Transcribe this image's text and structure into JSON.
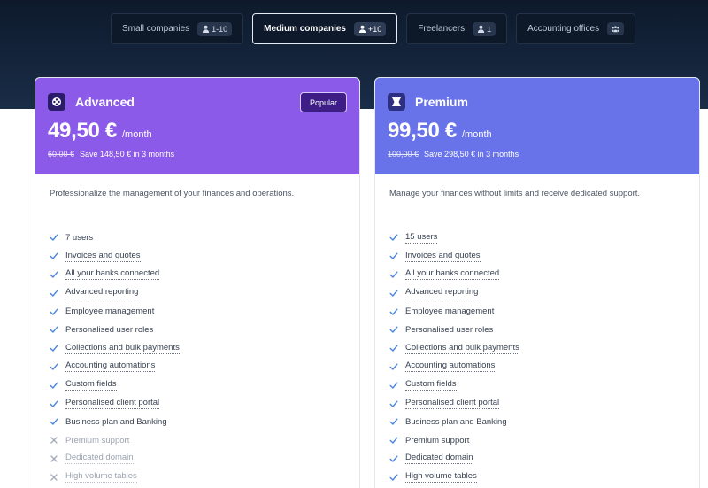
{
  "tabs": [
    {
      "label": "Small companies",
      "count": "1-10",
      "icon": "user-icon",
      "active": false
    },
    {
      "label": "Medium companies",
      "count": "+10",
      "icon": "user-icon",
      "active": true
    },
    {
      "label": "Freelancers",
      "count": "1",
      "icon": "user-icon",
      "active": false
    },
    {
      "label": "Accounting offices",
      "count": "",
      "icon": "group-icon",
      "active": false
    }
  ],
  "plans": {
    "advanced": {
      "name": "Advanced",
      "badge": "Popular",
      "price": "49,50 €",
      "period": "/month",
      "old_price": "60,00 €",
      "save": "Save 148,50 € in 3 months",
      "description": "Professionalize the management of your finances and operations.",
      "color": "#8c5ae8",
      "features": [
        {
          "label": "7 users",
          "included": true,
          "dotted": false
        },
        {
          "label": "Invoices and quotes",
          "included": true,
          "dotted": true
        },
        {
          "label": "All your banks connected",
          "included": true,
          "dotted": true
        },
        {
          "label": "Advanced reporting",
          "included": true,
          "dotted": true
        },
        {
          "label": "Employee management",
          "included": true,
          "dotted": false
        },
        {
          "label": "Personalised user roles",
          "included": true,
          "dotted": false
        },
        {
          "label": "Collections and bulk payments",
          "included": true,
          "dotted": true
        },
        {
          "label": "Accounting automations",
          "included": true,
          "dotted": true
        },
        {
          "label": "Custom fields",
          "included": true,
          "dotted": true
        },
        {
          "label": "Personalised client portal",
          "included": true,
          "dotted": true
        },
        {
          "label": "Business plan and Banking",
          "included": true,
          "dotted": false
        },
        {
          "label": "Premium support",
          "included": false,
          "dotted": false
        },
        {
          "label": "Dedicated domain",
          "included": false,
          "dotted": true
        },
        {
          "label": "High volume tables",
          "included": false,
          "dotted": true
        }
      ]
    },
    "premium": {
      "name": "Premium",
      "price": "99,50 €",
      "period": "/month",
      "old_price": "100,00 €",
      "save": "Save 298,50 € in 3 months",
      "description": "Manage your finances without limits and receive dedicated support.",
      "color": "#6873e9",
      "features": [
        {
          "label": "15 users",
          "included": true,
          "dotted": true
        },
        {
          "label": "Invoices and quotes",
          "included": true,
          "dotted": true
        },
        {
          "label": "All your banks connected",
          "included": true,
          "dotted": true
        },
        {
          "label": "Advanced reporting",
          "included": true,
          "dotted": true
        },
        {
          "label": "Employee management",
          "included": true,
          "dotted": false
        },
        {
          "label": "Personalised user roles",
          "included": true,
          "dotted": false
        },
        {
          "label": "Collections and bulk payments",
          "included": true,
          "dotted": true
        },
        {
          "label": "Accounting automations",
          "included": true,
          "dotted": true
        },
        {
          "label": "Custom fields",
          "included": true,
          "dotted": true
        },
        {
          "label": "Personalised client portal",
          "included": true,
          "dotted": true
        },
        {
          "label": "Business plan and Banking",
          "included": true,
          "dotted": false
        },
        {
          "label": "Premium support",
          "included": true,
          "dotted": false
        },
        {
          "label": "Dedicated domain",
          "included": true,
          "dotted": true
        },
        {
          "label": "High volume tables",
          "included": true,
          "dotted": true
        }
      ]
    }
  },
  "colors": {
    "check": "#4a86e0",
    "cross": "#a3acb8"
  }
}
